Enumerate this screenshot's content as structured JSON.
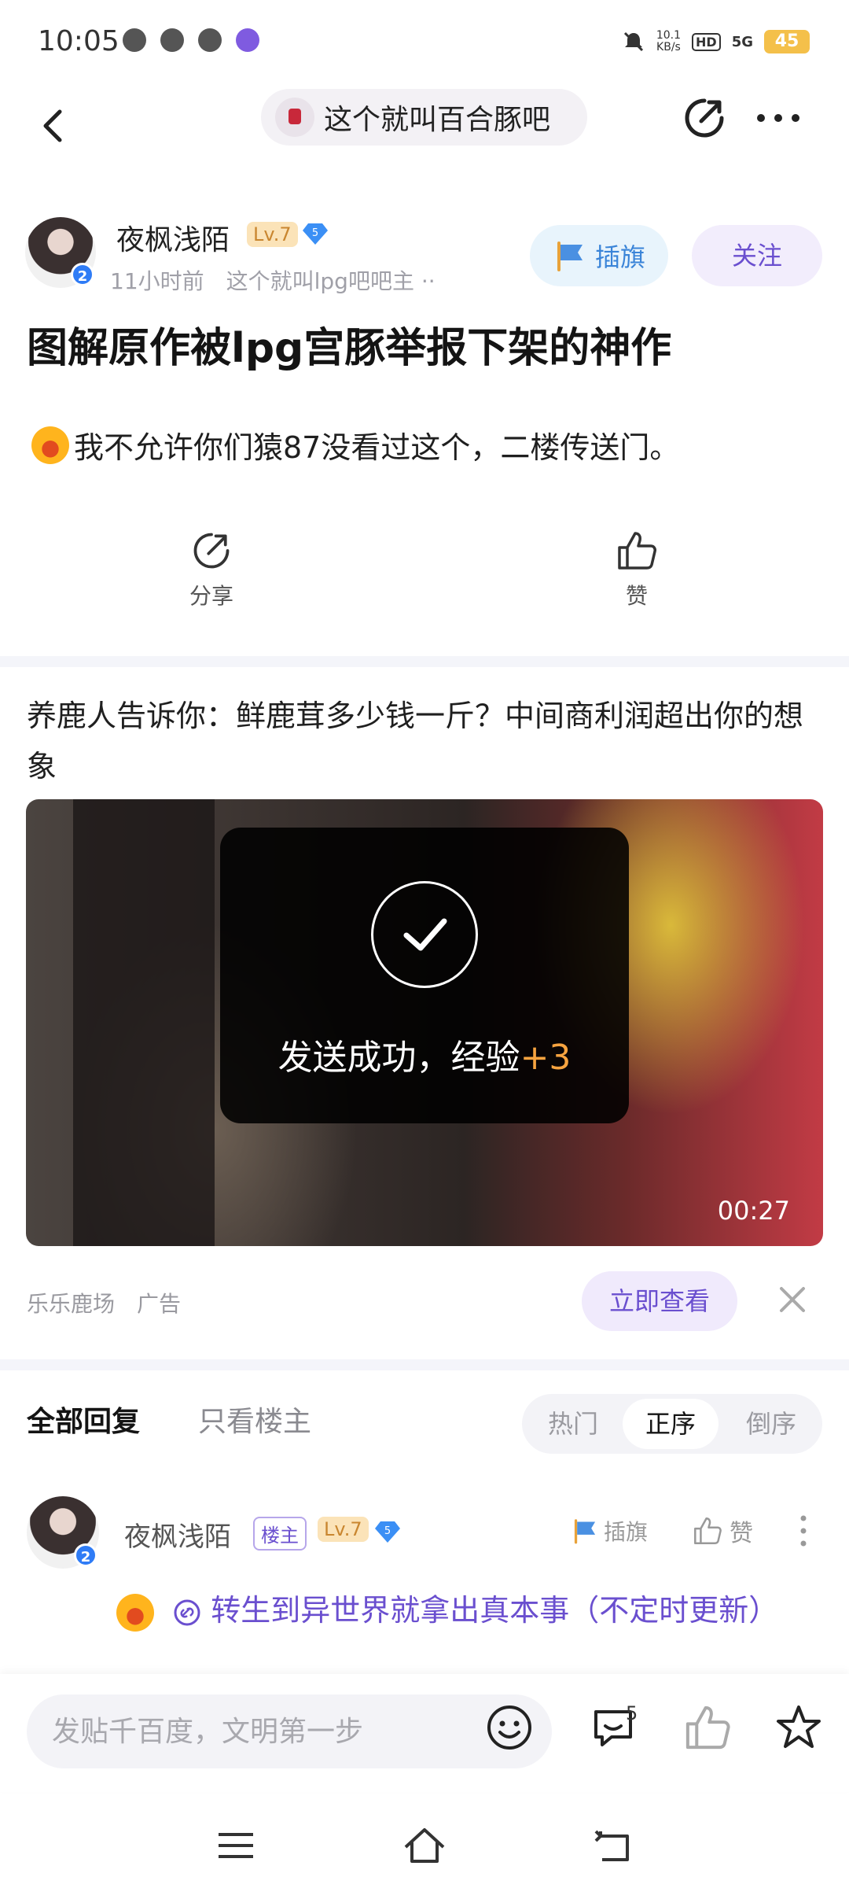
{
  "status": {
    "time": "10:05",
    "speed_value": "10.1",
    "speed_unit": "KB/s",
    "hd": "HD",
    "network": "5G",
    "battery": "45"
  },
  "nav": {
    "forum_name": "这个就叫百合豚吧"
  },
  "post": {
    "author": "夜枫浅陌",
    "level": "Lv.7",
    "badge_number": "5",
    "avatar_badge": "2",
    "time_forum": "11小时前　这个就叫lpg吧吧主 ··",
    "flag_label": "插旗",
    "follow_label": "关注",
    "title": "图解原作被lpg宫豚举报下架的神作",
    "body": "我不允许你们猿87没看过这个，二楼传送门。",
    "share_label": "分享",
    "like_label": "赞"
  },
  "ad": {
    "title": "养鹿人告诉你：鲜鹿茸多少钱一斤？中间商利润超出你的想象",
    "duration": "00:27",
    "source": "乐乐鹿场",
    "tag": "广告",
    "cta": "立即查看"
  },
  "toast": {
    "text": "发送成功，经验",
    "exp": "+3"
  },
  "replies": {
    "tab_all": "全部回复",
    "tab_op": "只看楼主",
    "sort": [
      "热门",
      "正序",
      "倒序"
    ],
    "active_sort": "正序"
  },
  "reply": {
    "author": "夜枫浅陌",
    "op_tag": "楼主",
    "level": "Lv.7",
    "badge_number": "5",
    "avatar_badge": "2",
    "flag_label": "插旗",
    "like_label": "赞",
    "link_text": "转生到异世界就拿出真本事（不定时更新）"
  },
  "bottom": {
    "input_placeholder": "发贴千百度，文明第一步",
    "reply_count": "5"
  },
  "colors": {
    "accent": "#6a4fcf",
    "flag_blue": "#3a84d8",
    "level_bg": "#fbe3b8",
    "exp_orange": "#f7a440"
  },
  "icons": [
    "back-icon",
    "share-icon",
    "more-icon",
    "flag-icon",
    "thumb-up-icon",
    "close-icon",
    "check-icon",
    "emoji-icon",
    "comment-icon",
    "star-icon",
    "menu-icon",
    "home-icon",
    "return-icon",
    "link-icon",
    "gem-badge-icon"
  ]
}
